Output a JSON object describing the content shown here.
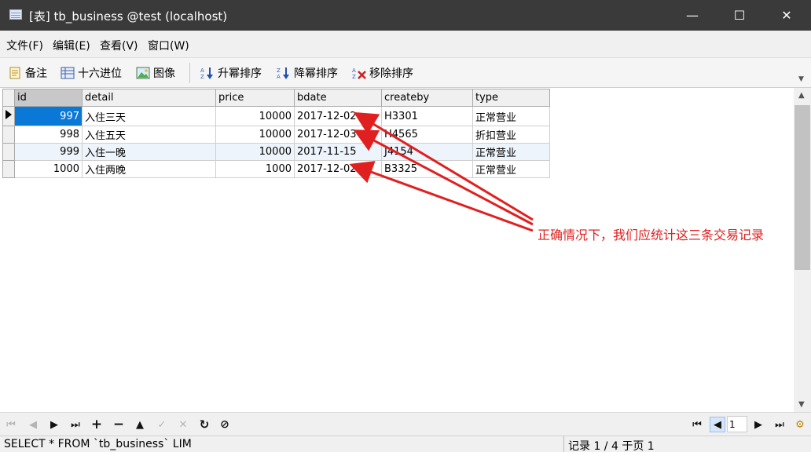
{
  "window": {
    "title": "[表] tb_business @test (localhost)",
    "minimize": "—",
    "maximize": "☐",
    "close": "✕"
  },
  "menu": [
    "文件(F)",
    "编辑(E)",
    "查看(V)",
    "窗口(W)"
  ],
  "toolbar": {
    "memo": "备注",
    "hex": "十六进位",
    "image": "图像",
    "sort_asc": "升幂排序",
    "sort_desc": "降幂排序",
    "remove_sort": "移除排序"
  },
  "table": {
    "columns": [
      "id",
      "detail",
      "price",
      "bdate",
      "createby",
      "type"
    ],
    "rows": [
      [
        "997",
        "入住三天",
        "10000",
        "2017-12-02",
        "H3301",
        "正常营业"
      ],
      [
        "998",
        "入住五天",
        "10000",
        "2017-12-03",
        "H4565",
        "折扣营业"
      ],
      [
        "999",
        "入住一晚",
        "10000",
        "2017-11-15",
        "J4154",
        "正常营业"
      ],
      [
        "1000",
        "入住两晚",
        "1000",
        "2017-12-02",
        "B3325",
        "正常营业"
      ]
    ]
  },
  "annotation": "正确情况下，我们应统计这三条交易记录",
  "navigation": {
    "page_value": "1"
  },
  "status": {
    "sql": "SELECT * FROM `tb_business` LIM",
    "record": "记录 1 / 4 于页 1"
  },
  "colors": {
    "titlebar": "#3a3a3a",
    "selection": "#0a78d7",
    "annotation": "#e02020"
  }
}
